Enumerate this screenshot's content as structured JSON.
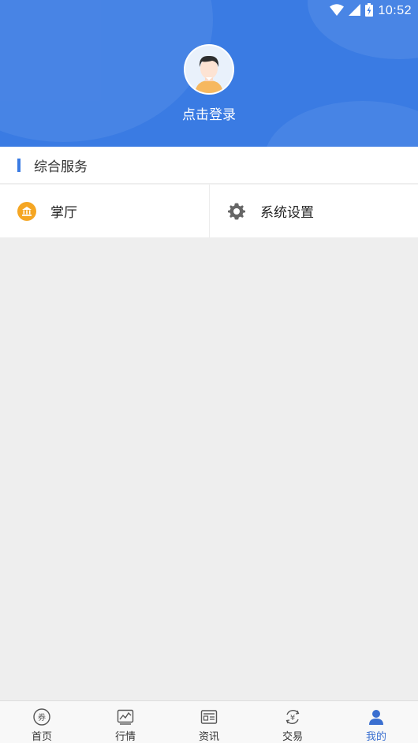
{
  "status_bar": {
    "time": "10:52"
  },
  "profile": {
    "login_label": "点击登录"
  },
  "section": {
    "title": "综合服务"
  },
  "services": [
    {
      "label": "掌厅",
      "icon": "bank-icon"
    },
    {
      "label": "系统设置",
      "icon": "gear-icon"
    }
  ],
  "tabbar": {
    "tabs": [
      {
        "label": "首页",
        "icon": "coupon-icon",
        "active": false
      },
      {
        "label": "行情",
        "icon": "chart-icon",
        "active": false
      },
      {
        "label": "资讯",
        "icon": "news-icon",
        "active": false
      },
      {
        "label": "交易",
        "icon": "yuan-exchange-icon",
        "active": false
      },
      {
        "label": "我的",
        "icon": "user-icon",
        "active": true
      }
    ]
  },
  "colors": {
    "header_bg": "#3a7be3",
    "accent": "#3a6fd0",
    "bank_icon": "#f5a623",
    "gear_icon": "#666666",
    "page_bg": "#eeeeee"
  }
}
